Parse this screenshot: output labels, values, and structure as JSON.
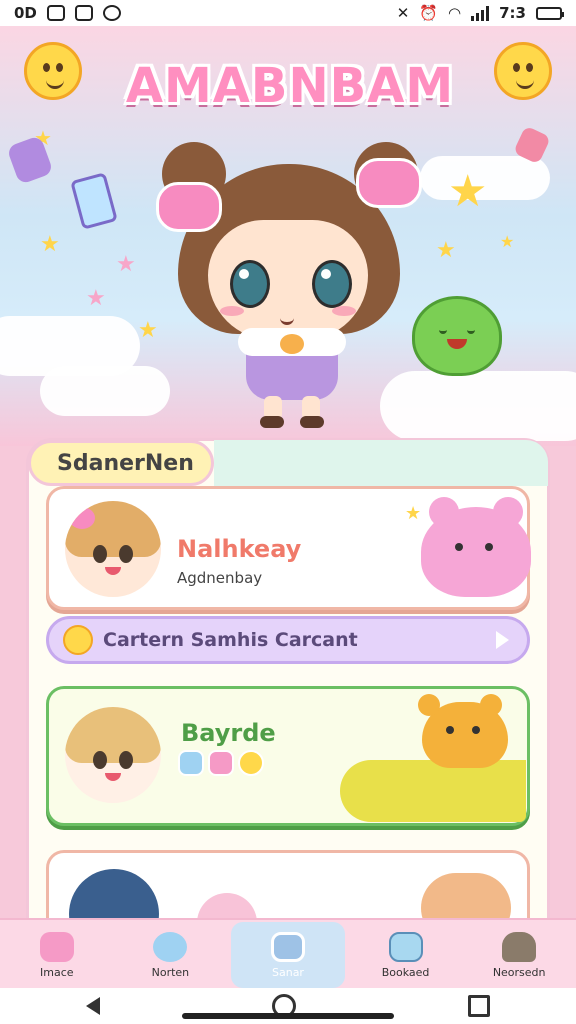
{
  "status_bar": {
    "left_text": "0D",
    "time": "7:3"
  },
  "header": {
    "title": "AMABNBAM"
  },
  "section": {
    "title": "SdanerNen"
  },
  "cards": [
    {
      "title": "Nalhkeay",
      "subtitle": "Agdnenbay"
    },
    {
      "title": "Bayrde",
      "subtitle": ""
    }
  ],
  "banner": {
    "text": "Cartern Samhis Carcant"
  },
  "bottom_nav": {
    "items": [
      {
        "label": "Imace"
      },
      {
        "label": "Norten"
      },
      {
        "label": "Sanar"
      },
      {
        "label": "Bookaed"
      },
      {
        "label": "Neorsedn"
      }
    ],
    "active_index": 2
  },
  "colors": {
    "accent_pink": "#f78bc0",
    "banner_purple": "#e5d3fa",
    "card_green": "#6bbf63",
    "nav_bg": "#fcd9e6"
  }
}
